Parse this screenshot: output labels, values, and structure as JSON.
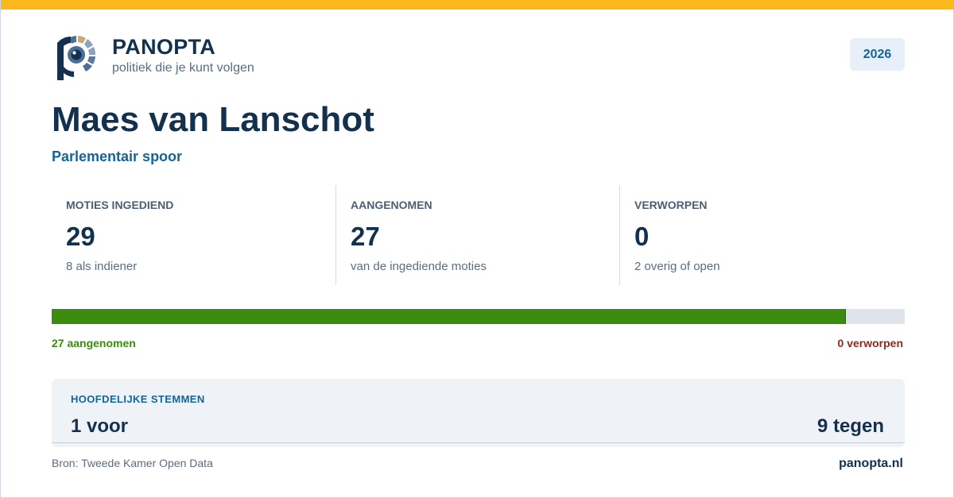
{
  "colors": {
    "accent_bar": "#fbb81c",
    "navy": "#13304f",
    "blue": "#14649a",
    "green": "#3a8b0e",
    "red": "#8a2b1f"
  },
  "brand": {
    "name": "PANOPTA",
    "tagline": "politiek die je kunt volgen",
    "logo_icon": "panopta-eye-logo-icon"
  },
  "year_badge": "2026",
  "person": {
    "name": "Maes van Lanschot",
    "subtitle": "Parlementair spoor"
  },
  "stats": [
    {
      "label": "MOTIES INGEDIEND",
      "value": "29",
      "sub": "8 als indiener"
    },
    {
      "label": "AANGENOMEN",
      "value": "27",
      "sub": "van de ingediende moties"
    },
    {
      "label": "VERWORPEN",
      "value": "0",
      "sub": "2 overig of open"
    }
  ],
  "progress": {
    "accepted_fraction": 0.931,
    "accepted_label": "27 aangenomen",
    "rejected_label": "0 verworpen"
  },
  "votes": {
    "title": "HOOFDELIJKE STEMMEN",
    "for": "1 voor",
    "against": "9 tegen"
  },
  "footer": {
    "source": "Bron: Tweede Kamer Open Data",
    "site": "panopta.nl"
  }
}
